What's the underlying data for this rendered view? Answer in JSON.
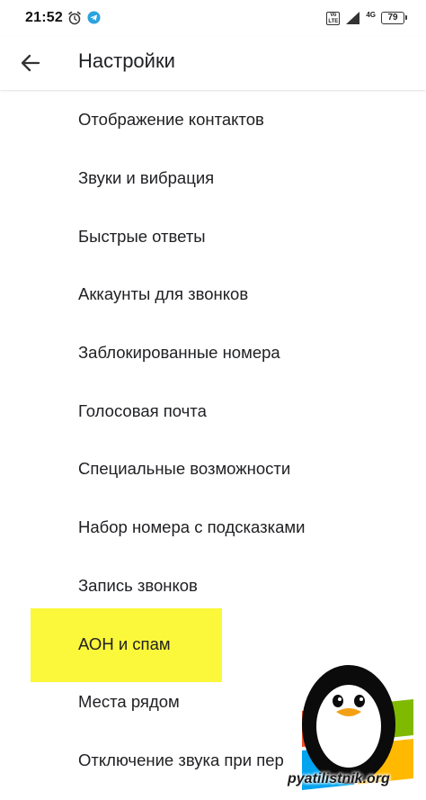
{
  "status_bar": {
    "time": "21:52",
    "volte_label": "Vo LTE",
    "network_label": "4G",
    "battery_level": "79",
    "icons": [
      "alarm-icon",
      "telegram-icon",
      "volte-icon",
      "signal-icon",
      "battery-icon"
    ]
  },
  "app_bar": {
    "back_icon": "arrow-left-icon",
    "title": "Настройки"
  },
  "settings": {
    "items": [
      {
        "label": "Отображение контактов"
      },
      {
        "label": "Звуки и вибрация"
      },
      {
        "label": "Быстрые ответы"
      },
      {
        "label": "Аккаунты для звонков"
      },
      {
        "label": "Заблокированные номера"
      },
      {
        "label": "Голосовая почта"
      },
      {
        "label": "Специальные возможности"
      },
      {
        "label": "Набор номера с подсказками"
      },
      {
        "label": "Запись звонков"
      },
      {
        "label": "АОН и спам",
        "highlighted": true
      },
      {
        "label": "Места рядом"
      },
      {
        "label": "Отключение звука при пер"
      }
    ]
  },
  "watermark": {
    "text": "pyatilistnik.org"
  },
  "colors": {
    "highlight": "#fbf73a",
    "telegram": "#2aa3e0",
    "text": "#202124",
    "penguin_body": "#000000",
    "penguin_beak": "#f2a116"
  }
}
